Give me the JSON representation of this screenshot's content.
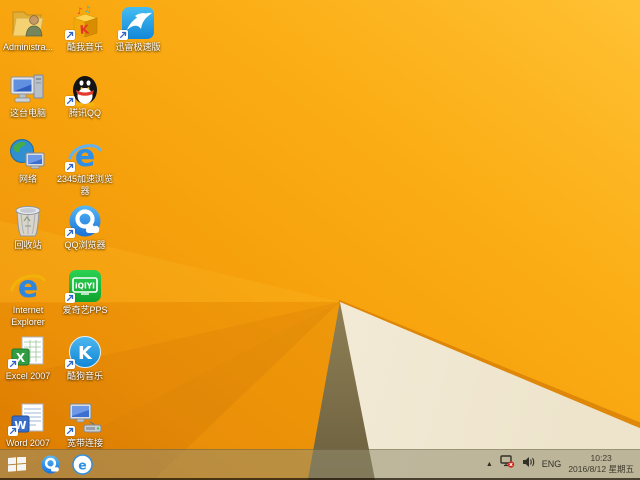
{
  "desktop": {
    "icons": [
      {
        "id": "user-folder",
        "label": "Administra..."
      },
      {
        "id": "this-pc",
        "label": "这台电脑"
      },
      {
        "id": "network",
        "label": "网络"
      },
      {
        "id": "recycle-bin",
        "label": "回收站"
      },
      {
        "id": "internet-explorer",
        "label": "Internet Explorer"
      },
      {
        "id": "excel-2007",
        "label": "Excel 2007"
      },
      {
        "id": "word-2007",
        "label": "Word 2007"
      },
      {
        "id": "kuwo-music",
        "label": "酷我音乐"
      },
      {
        "id": "tencent-qq",
        "label": "腾讯QQ"
      },
      {
        "id": "2345-browser",
        "label": "2345加速浏览器"
      },
      {
        "id": "qq-browser",
        "label": "QQ浏览器"
      },
      {
        "id": "iqiyi-pps",
        "label": "爱奇艺PPS"
      },
      {
        "id": "kugou-music",
        "label": "酷狗音乐"
      },
      {
        "id": "broadband",
        "label": "宽带连接"
      },
      {
        "id": "thunder",
        "label": "迅雷极速版"
      }
    ]
  },
  "taskbar": {
    "pinned_icons": [
      "windows-start",
      "qq-browser",
      "browser-e"
    ],
    "tray": {
      "icons": [
        "show-hidden-icons",
        "network-disconnected",
        "volume"
      ],
      "language": "ENG",
      "time": "10:23",
      "date": "2016/8/12 星期五"
    }
  },
  "colors": {
    "wallpaper_orange": "#f7a30d",
    "wallpaper_highlight": "#ffc133",
    "wallpaper_cream": "#f4eedc",
    "wallpaper_khaki": "#97875a",
    "taskbar_tint": "#948e70",
    "label_text": "#ffffff",
    "start_logo": "#ffffff"
  }
}
